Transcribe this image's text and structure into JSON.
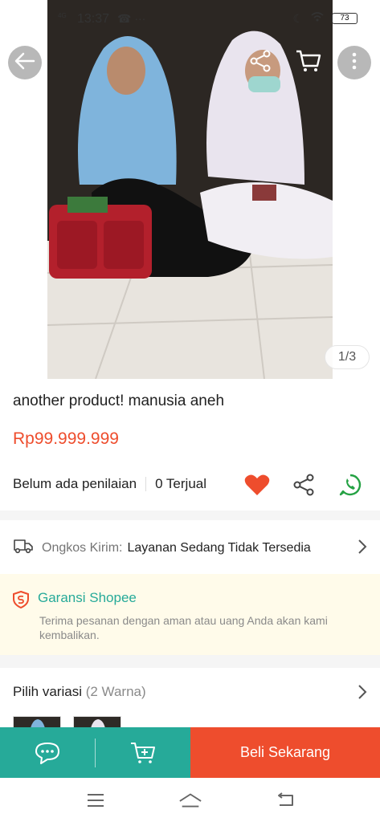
{
  "status_bar": {
    "time": "13:37",
    "network": "4G",
    "battery": "73"
  },
  "product": {
    "image_counter": "1/3",
    "title": "another product! manusia aneh",
    "price": "Rp99.999.999",
    "rating_text": "Belum ada penilaian",
    "sold_text": "0 Terjual"
  },
  "shipping": {
    "label": "Ongkos Kirim:",
    "value": "Layanan Sedang Tidak Tersedia"
  },
  "guarantee": {
    "title": "Garansi Shopee",
    "description": "Terima pesanan dengan aman atau uang Anda akan kami kembalikan."
  },
  "variant": {
    "label": "Pilih variasi",
    "count": "(2 Warna)"
  },
  "action_bar": {
    "buy_label": "Beli Sekarang"
  },
  "colors": {
    "brand_orange": "#ee4d2d",
    "teal": "#26aa99",
    "whatsapp_green": "#25a244",
    "guarantee_bg": "#fffbea"
  },
  "icons": [
    "arrow-left-icon",
    "share-icon",
    "cart-icon",
    "more-vertical-icon",
    "heart-icon",
    "whatsapp-icon",
    "truck-icon",
    "chevron-right-icon",
    "shield-icon",
    "chat-icon",
    "add-to-cart-icon",
    "menu-icon",
    "home-icon",
    "back-nav-icon"
  ]
}
